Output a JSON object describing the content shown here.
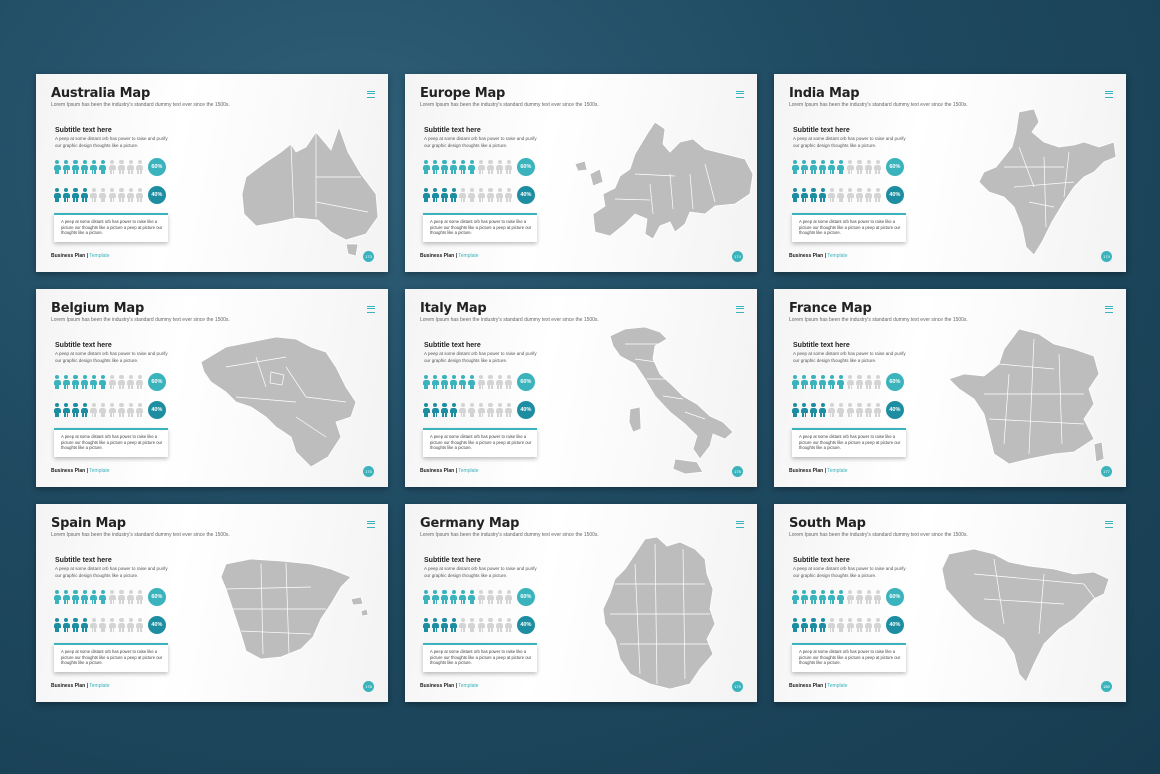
{
  "colors": {
    "teal": "#3ab3bd",
    "teal_dark": "#1d8ea2",
    "gray_person": "#d4d4d4",
    "map_fill": "#bdbdbd",
    "map_stroke": "#ffffff"
  },
  "shared": {
    "description": "Lorem Ipsum has been the industry's standard dummy text ever since the 1500s.",
    "subtitle": "Subtitle text here",
    "body": "A peep at some distant orb has power to raise and purify our graphic design thoughts like a picture.",
    "card_text": "A peep at some distant orb has power to raise like a picture our thoughts like a picture a peep at picture our thoughts like a picture.",
    "pct1": "60%",
    "pct2": "40%",
    "pct1_level": 0.6,
    "pct2_level": 0.4,
    "footer_brand": "Business Plan |",
    "footer_template": "Template",
    "menu_icon": "hamburger-menu-icon"
  },
  "slides": [
    {
      "title": "Australia Map",
      "page": "173",
      "map": "australia"
    },
    {
      "title": "Europe Map",
      "page": "174",
      "map": "europe"
    },
    {
      "title": "India Map",
      "page": "174",
      "map": "india"
    },
    {
      "title": "Belgium Map",
      "page": "175",
      "map": "belgium"
    },
    {
      "title": "Italy Map",
      "page": "176",
      "map": "italy"
    },
    {
      "title": "France Map",
      "page": "177",
      "map": "france"
    },
    {
      "title": "Spain Map",
      "page": "178",
      "map": "spain"
    },
    {
      "title": "Germany Map",
      "page": "179",
      "map": "germany"
    },
    {
      "title": "South Map",
      "page": "180",
      "map": "south"
    }
  ]
}
